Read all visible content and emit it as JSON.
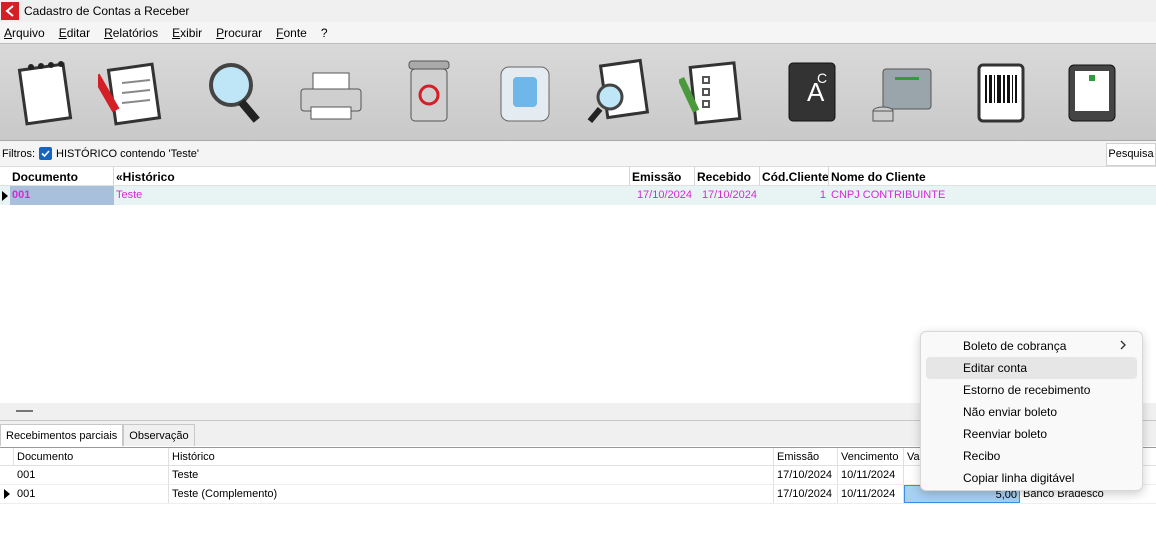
{
  "window": {
    "title": "Cadastro de Contas a Receber"
  },
  "menu": [
    "Arquivo",
    "Editar",
    "Relatórios",
    "Exibir",
    "Procurar",
    "Fonte",
    "?"
  ],
  "toolbar": [
    "notepad-icon",
    "edit-note-icon",
    "magnifier-icon",
    "printer-icon",
    "trash-icon",
    "water-cooler-icon",
    "search-note-icon",
    "checklist-icon",
    "abc-icon",
    "folder-database-icon",
    "barcode-icon",
    "tablet-tool-icon"
  ],
  "filters": {
    "label": "Filtros:",
    "text": "HISTÓRICO contendo 'Teste'",
    "search_button": "Pesquisa"
  },
  "grid": {
    "headers": [
      "Documento",
      "«Histórico",
      "Emissão",
      "Recebido",
      "Cód.Cliente",
      "Nome do Cliente"
    ],
    "rows": [
      {
        "documento": "001",
        "historico": "Teste",
        "emissao": "17/10/2024",
        "recebido": "17/10/2024",
        "cod_cliente": "1",
        "nome_cliente": "CNPJ CONTRIBUINTE"
      }
    ]
  },
  "tabs": [
    "Recebimentos parciais",
    "Observação"
  ],
  "sub_grid": {
    "headers": [
      "Documento",
      "Histórico",
      "Emissão",
      "Vencimento",
      "Va"
    ],
    "rows": [
      {
        "documento": "001",
        "historico": "Teste",
        "emissao": "17/10/2024",
        "vencimento": "10/11/2024",
        "valor": "",
        "banco": ""
      },
      {
        "documento": "001",
        "historico": "Teste (Complemento)",
        "emissao": "17/10/2024",
        "vencimento": "10/11/2024",
        "valor": "5,00",
        "banco": "Banco Bradesco"
      }
    ]
  },
  "context_menu": [
    {
      "label": "Boleto de cobrança",
      "submenu": true
    },
    {
      "label": "Editar conta"
    },
    {
      "label": "Estorno de recebimento"
    },
    {
      "label": "Não enviar boleto"
    },
    {
      "label": "Reenviar boleto"
    },
    {
      "label": "Recibo"
    },
    {
      "label": "Copiar linha digitável"
    }
  ],
  "colors": {
    "accent": "#1565c0",
    "row_text": "#d42ad4",
    "row_bg": "#e8f4f4",
    "app_icon": "#d41f26"
  }
}
